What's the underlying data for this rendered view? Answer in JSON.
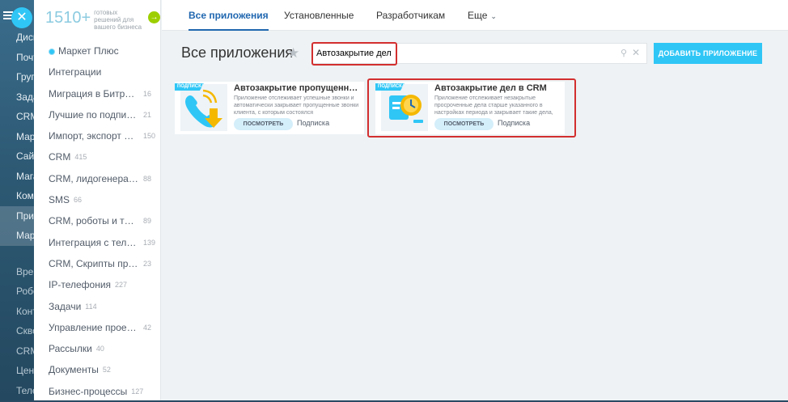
{
  "bg_menu": {
    "items": [
      "Диск",
      "Почта",
      "Группы",
      "Задачи",
      "CRM",
      "Маркетинг",
      "Сайты",
      "Магазины",
      "Компания",
      "Приложения",
      "Маркет",
      "Время",
      "Роботы",
      "Контакт",
      "Сквозная",
      "CRM-формы",
      "Центр",
      "Телефония"
    ]
  },
  "promo": {
    "count": "1510+",
    "text": "готовых решений для вашего бизнеса",
    "arrow": "→"
  },
  "sidebar": {
    "items": [
      {
        "label": "Маркет Плюс",
        "count": ""
      },
      {
        "label": "Интеграции",
        "count": ""
      },
      {
        "label": "Миграция в Битрикс24",
        "count": "16"
      },
      {
        "label": "Лучшие по подписке",
        "count": "21"
      },
      {
        "label": "Импорт, экспорт дан...",
        "count": "150"
      },
      {
        "label": "CRM",
        "count": "415"
      },
      {
        "label": "CRM, лидогенерация",
        "count": "88"
      },
      {
        "label": "SMS",
        "count": "66"
      },
      {
        "label": "CRM, роботы и тригг...",
        "count": "89"
      },
      {
        "label": "Интеграция с телеф...",
        "count": "139"
      },
      {
        "label": "CRM, Скрипты продаж",
        "count": "23"
      },
      {
        "label": "IP-телефония",
        "count": "227"
      },
      {
        "label": "Задачи",
        "count": "114"
      },
      {
        "label": "Управление проекта...",
        "count": "42"
      },
      {
        "label": "Рассылки",
        "count": "40"
      },
      {
        "label": "Документы",
        "count": "52"
      },
      {
        "label": "Бизнес-процессы",
        "count": "127"
      }
    ]
  },
  "tabs": {
    "all": "Все приложения",
    "installed": "Установленные",
    "developers": "Разработчикам",
    "more": "Еще"
  },
  "header": {
    "title": "Все приложения",
    "add_button": "ДОБАВИТЬ ПРИЛОЖЕНИЕ"
  },
  "search": {
    "value": "Автозакрытие дел"
  },
  "cards": [
    {
      "ribbon": "ПОДПИСКА",
      "title": "Автозакрытие пропущенных з...",
      "desc": "Приложение отслеживает успешные звонки и автоматически закрывает пропущенные звонки клиента, с которым состоялся",
      "button": "ПОСМОТРЕТЬ",
      "sub": "Подписка"
    },
    {
      "ribbon": "ПОДПИСКА",
      "title": "Автозакрытие дел в CRM",
      "desc": "Приложение отслеживает незакрытые просроченные дела старше указанного в настройках периода и закрывает такие дела,",
      "button": "ПОСМОТРЕТЬ",
      "sub": "Подписка"
    }
  ],
  "colors": {
    "accent": "#2fc6f6",
    "tab_active": "#2067b0",
    "highlight": "#d32f2f"
  }
}
